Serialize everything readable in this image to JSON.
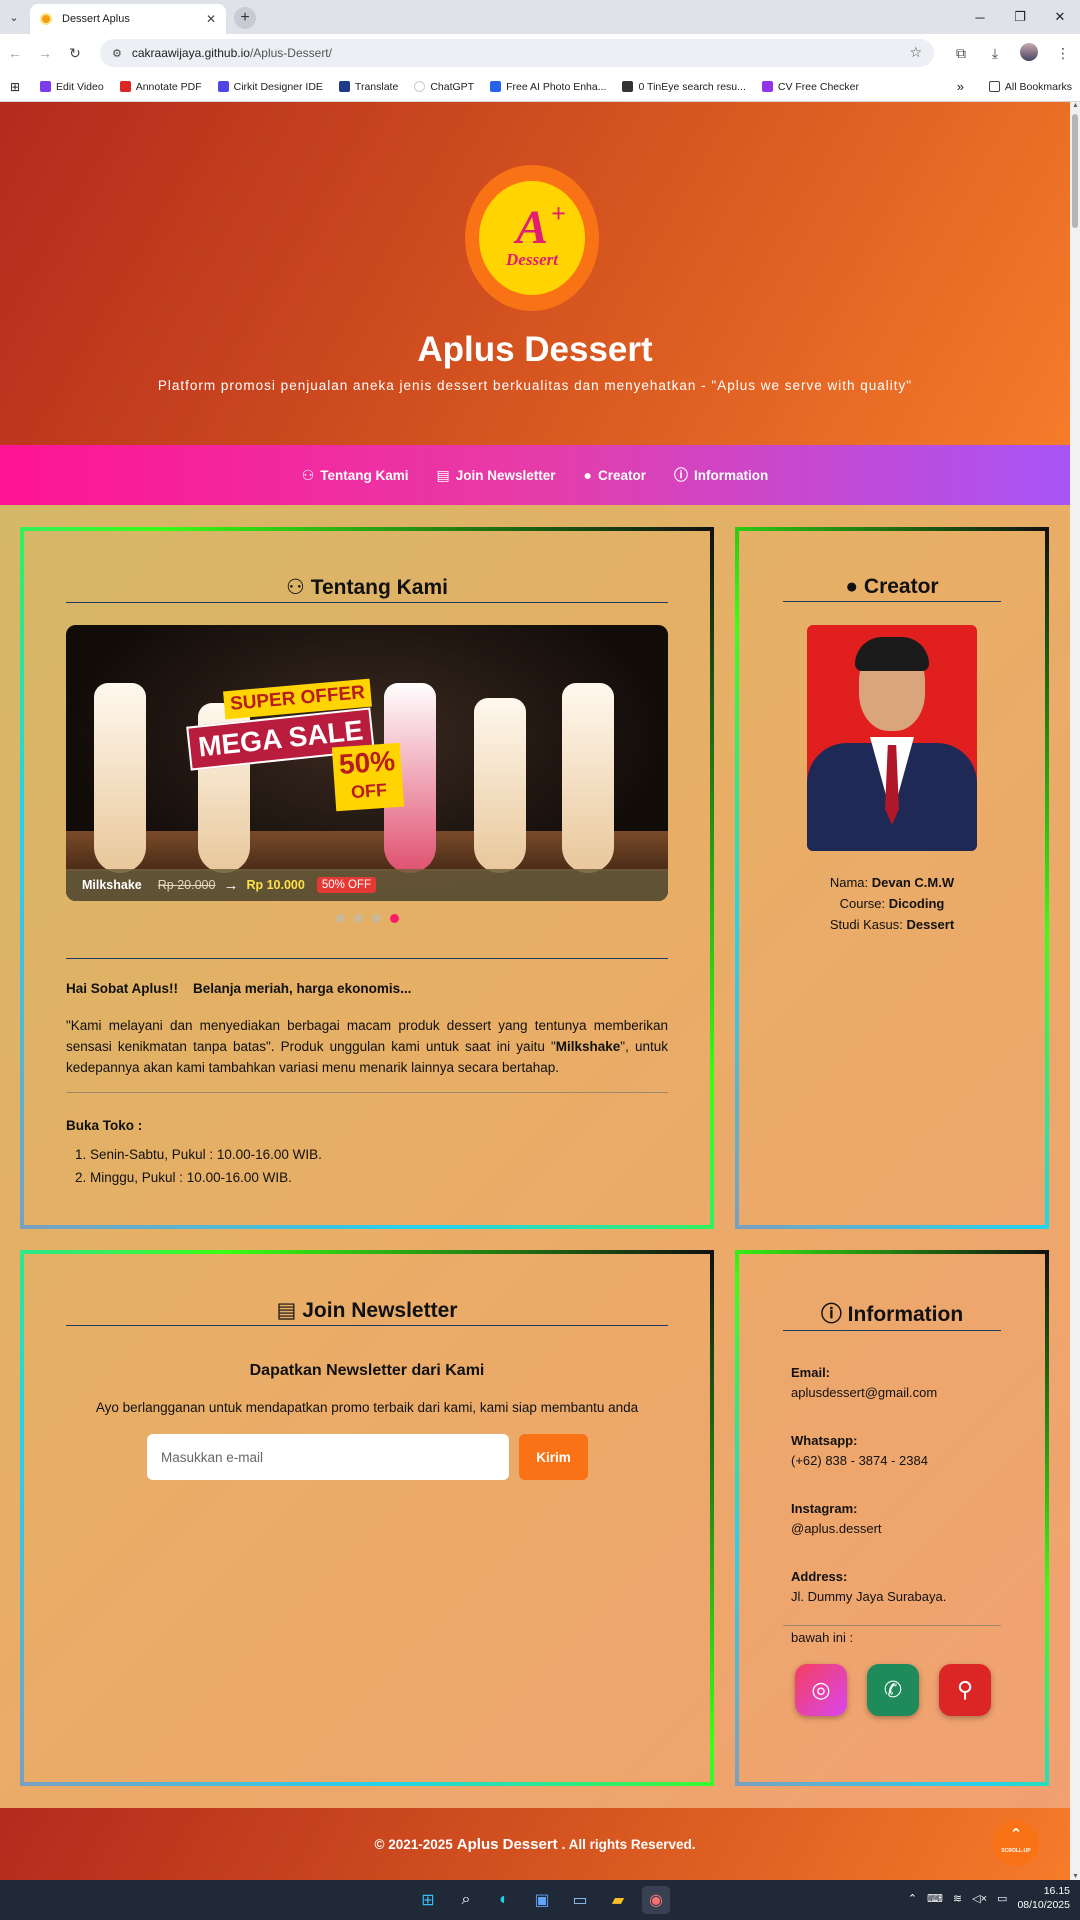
{
  "browser": {
    "tab_title": "Dessert Aplus",
    "url_host": "cakraawijaya.github.io",
    "url_path": "/Aplus-Dessert/",
    "bookmarks": [
      "Edit Video",
      "Annotate PDF",
      "Cirkit Designer IDE",
      "Translate",
      "ChatGPT",
      "Free AI Photo Enha...",
      "0 TinEye search resu...",
      "CV Free Checker"
    ],
    "all_bookmarks": "All Bookmarks"
  },
  "header": {
    "logo_letter": "A",
    "logo_plus": "+",
    "logo_word": "Dessert",
    "title": "Aplus Dessert",
    "subtitle": "Platform promosi penjualan aneka jenis dessert berkualitas dan menyehatkan - \"Aplus we serve with quality\""
  },
  "nav": [
    "Tentang Kami",
    "Join Newsletter",
    "Creator",
    "Information"
  ],
  "about": {
    "title": "Tentang Kami",
    "banner_super": "SUPER OFFER",
    "banner_mega": "MEGA SALE",
    "banner_pct": "50%",
    "banner_off": "OFF",
    "product": "Milkshake",
    "old_price": "Rp 20.000",
    "arrow": "→",
    "new_price": "Rp 10.000",
    "discount": "50% OFF",
    "slide_total": 4,
    "slide_active": 4,
    "greeting": "Hai Sobat Aplus!!    Belanja meriah, harga ekonomis...",
    "desc_pre": "\"Kami melayani dan menyediakan berbagai macam produk dessert yang tentunya memberikan sensasi kenikmatan tanpa batas\". Produk unggulan kami untuk saat ini yaitu \"",
    "desc_bold": "Milkshake",
    "desc_post": "\", untuk kedepannya akan kami tambahkan variasi menu menarik lainnya secara bertahap.",
    "hours_title": "Buka Toko :",
    "hours": [
      "Senin-Sabtu, Pukul : 10.00-16.00 WIB.",
      "Minggu, Pukul : 10.00-16.00 WIB."
    ]
  },
  "creator": {
    "title": "Creator",
    "name_label": "Nama:",
    "name": "Devan C.M.W",
    "course_label": "Course:",
    "course": "Dicoding",
    "case_label": "Studi Kasus:",
    "case": "Dessert"
  },
  "newsletter": {
    "title": "Join Newsletter",
    "heading": "Dapatkan Newsletter dari Kami",
    "desc": "Ayo berlangganan untuk mendapatkan promo terbaik dari kami, kami siap membantu anda",
    "placeholder": "Masukkan e-mail",
    "button": "Kirim"
  },
  "information": {
    "title": "Information",
    "email_label": "Email:",
    "email": "aplusdessert@gmail.com",
    "wa_label": "Whatsapp:",
    "wa": "(+62) 838 - 3874 - 2384",
    "ig_label": "Instagram:",
    "ig": "@aplus.dessert",
    "addr_label": "Address:",
    "addr": "Jl. Dummy Jaya Surabaya.",
    "below": "bawah ini :"
  },
  "footer": {
    "pre": "© 2021-2025",
    "brand": "Aplus Dessert",
    "post": ". All rights Reserved.",
    "scroll_up": "SCROLL-UP"
  },
  "taskbar": {
    "time": "16.15",
    "date": "08/10/2025"
  },
  "colors": {
    "accent": "#f97316",
    "nav_start": "#ff1493",
    "nav_end": "#a855f7"
  }
}
